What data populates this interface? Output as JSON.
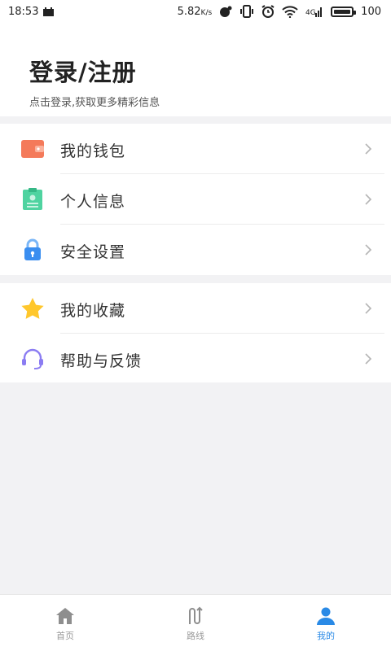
{
  "status_bar": {
    "time": "18:53",
    "speed": "5.82",
    "speed_unit": "K/s",
    "battery": "100"
  },
  "header": {
    "title": "登录/注册",
    "subtitle": "点击登录,获取更多精彩信息"
  },
  "menu_group_1": [
    {
      "label": "我的钱包",
      "icon": "wallet-icon",
      "color": "#f47a5a"
    },
    {
      "label": "个人信息",
      "icon": "id-card-icon",
      "color": "#4fd3a0"
    },
    {
      "label": "安全设置",
      "icon": "lock-icon",
      "color": "#3a8ef0"
    }
  ],
  "menu_group_2": [
    {
      "label": "我的收藏",
      "icon": "star-icon",
      "color": "#ffc72c"
    },
    {
      "label": "帮助与反馈",
      "icon": "headset-icon",
      "color": "#8b7cf2"
    }
  ],
  "tab_bar": {
    "active": "我的",
    "tabs": [
      {
        "label": "首页",
        "icon": "home-icon"
      },
      {
        "label": "路线",
        "icon": "route-icon"
      },
      {
        "label": "我的",
        "icon": "person-icon"
      }
    ],
    "active_color": "#2a8ae6",
    "inactive_color": "#9a9a9a"
  }
}
